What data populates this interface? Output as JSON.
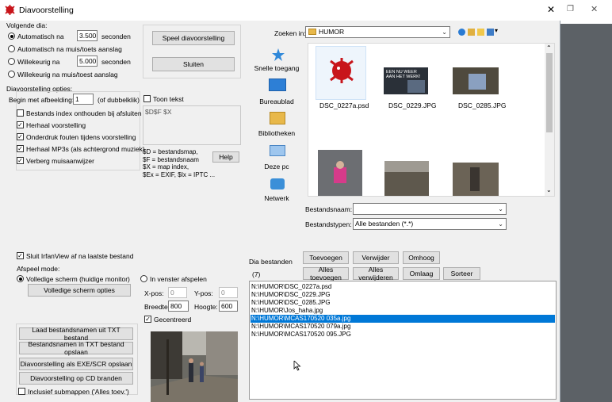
{
  "window": {
    "title": "Diavoorstelling",
    "close_glyph": "✕"
  },
  "background_window": {
    "restore_glyph": "❐",
    "close_glyph": "✕"
  },
  "next_slide": {
    "group_label": "Volgende dia:",
    "auto_label": "Automatisch na",
    "auto_value": "3.500",
    "seconds_label": "seconden",
    "auto_key_label": "Automatisch na muis/toets aanslag",
    "random_label": "Willekeurig na",
    "random_value": "5.000",
    "random_seconds_label": "seconden",
    "random_key_label": "Willekeurig na muis/toest aanslag"
  },
  "buttons": {
    "play": "Speel diavoorstelling",
    "close": "Sluiten",
    "help": "Help",
    "fullscreen_options": "Volledige scherm opties",
    "load_txt": "Laad bestandsnamen uit TXT bestand",
    "save_txt": "Bestandsnamen in TXT bestand opslaan",
    "save_exe": "Diavoorstelling als  EXE/SCR opslaan",
    "burn_cd": "Diavoorstelling op CD branden",
    "add": "Toevoegen",
    "remove": "Verwijder",
    "up": "Omhoog",
    "add_all": "Alles toevoegen",
    "remove_all": "Alles verwijderen",
    "down": "Omlaag",
    "sort": "Sorteer"
  },
  "options": {
    "group_label": "Diavoorstelling opties:",
    "start_label": "Begin met afbeelding:",
    "start_value": "1",
    "start_hint": "(of dubbelklik)",
    "remember_index": "Bestands index onthouden bij afsluiten",
    "loop": "Herhaal voorstelling",
    "suppress_errors": "Onderdruk fouten tijdens voorstelling",
    "loop_mp3": "Herhaal MP3s (als achtergrond muziek)",
    "hide_cursor": "Verberg muisaanwijzer",
    "show_text": "Toon tekst",
    "text_value": "$D$F $X",
    "legend": [
      "$D = bestandsmap,",
      "$F = bestandsnaam",
      "$X = map index,",
      "$Ex = EXIF, $Ix = IPTC ..."
    ]
  },
  "close_after_last": "Sluit IrfanView af na laatste bestand",
  "play_mode": {
    "group_label": "Afspeel mode:",
    "fullscreen": "Volledige scherm (huidige monitor)",
    "window": "In venster afspelen",
    "xpos_label": "X-pos:",
    "xpos_value": "0",
    "ypos_label": "Y-pos:",
    "ypos_value": "0",
    "width_label": "Breedte:",
    "width_value": "800",
    "height_label": "Hoogte:",
    "height_value": "600",
    "centered": "Gecentreerd"
  },
  "include_subfolders": "Inclusief submappen ('Alles toev.')",
  "browser": {
    "look_in_label": "Zoeken in:",
    "look_in_value": "HUMOR",
    "places": [
      "Snelle toegang",
      "Bureaublad",
      "Bibliotheken",
      "Deze pc",
      "Netwerk"
    ],
    "files": [
      {
        "name": "DSC_0227a.psd",
        "thumb_text": ""
      },
      {
        "name": "DSC_0229.JPG",
        "thumb_text": "EEN NU WEER AAN HET WERK!"
      },
      {
        "name": "DSC_0285.JPG",
        "thumb_text": ""
      },
      {
        "name": "",
        "thumb_text": ""
      },
      {
        "name": "",
        "thumb_text": ""
      },
      {
        "name": "",
        "thumb_text": ""
      }
    ],
    "filename_label": "Bestandsnaam:",
    "filename_value": "",
    "filetype_label": "Bestandstypen:",
    "filetype_value": "Alle bestanden (*.*)"
  },
  "slides": {
    "label": "Dia bestanden",
    "count": "(7)",
    "items": [
      "N:\\HUMOR\\DSC_0227a.psd",
      "N:\\HUMOR\\DSC_0229.JPG",
      "N:\\HUMOR\\DSC_0285.JPG",
      "N:\\HUMOR\\Jos_haha.jpg",
      "N:\\HUMOR\\MCAS170520 035a.jpg",
      "N:\\HUMOR\\MCAS170520 079a.jpg",
      "N:\\HUMOR\\MCAS170520 095.JPG"
    ],
    "selected_index": 4
  }
}
